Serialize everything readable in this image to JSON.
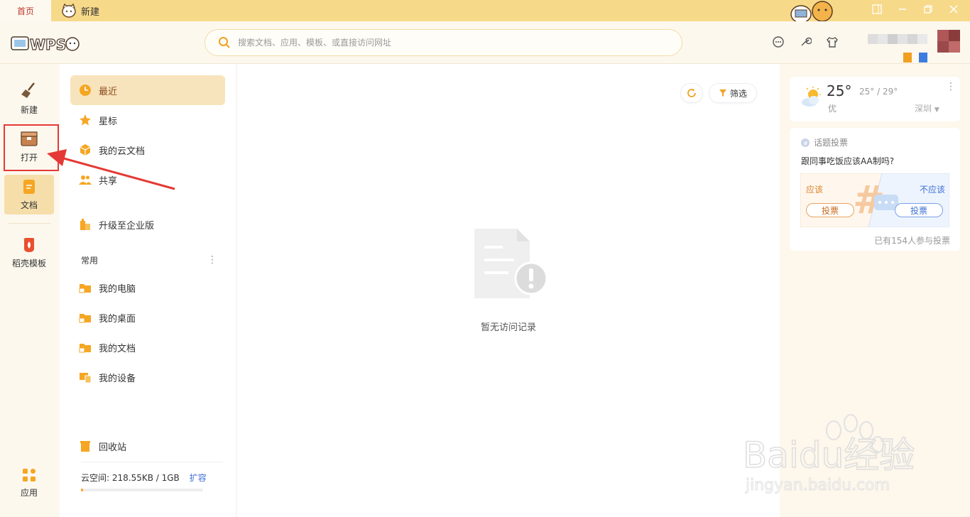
{
  "titlebar": {
    "home_tab": "首页",
    "new_tab": "新建"
  },
  "header": {
    "logo_text": "WPS",
    "search_placeholder": "搜索文档、应用、模板、或直接访问网址"
  },
  "leftnav": {
    "new": "新建",
    "open": "打开",
    "docs": "文档",
    "templates": "稻壳模板",
    "apps": "应用"
  },
  "menu": {
    "recent": "最近",
    "starred": "星标",
    "cloud_docs": "我的云文档",
    "shared": "共享",
    "upgrade": "升级至企业版",
    "common": "常用",
    "my_computer": "我的电脑",
    "my_desktop": "我的桌面",
    "my_docs": "我的文档",
    "my_devices": "我的设备",
    "recycle": "回收站"
  },
  "cloud": {
    "label": "云空间: 218.55KB / 1GB",
    "expand": "扩容",
    "usage_fraction": 0.02
  },
  "content": {
    "filter_label": "筛选",
    "empty_text": "暂无访问记录"
  },
  "weather": {
    "temp": "25°",
    "range": "25° / 29°",
    "air_quality": "优",
    "city": "深圳"
  },
  "poll": {
    "header": "话题投票",
    "question": "跟同事吃饭应该AA制吗?",
    "yes_label": "应该",
    "no_label": "不应该",
    "vote_yes": "投票",
    "vote_no": "投票",
    "count": "已有154人参与投票"
  },
  "watermark": {
    "brand": "Baidu经验",
    "url": "jingyan.baidu.com"
  },
  "colors": {
    "accent": "#f5a623",
    "titlebar": "#f7d98a",
    "highlight": "#e53935"
  }
}
